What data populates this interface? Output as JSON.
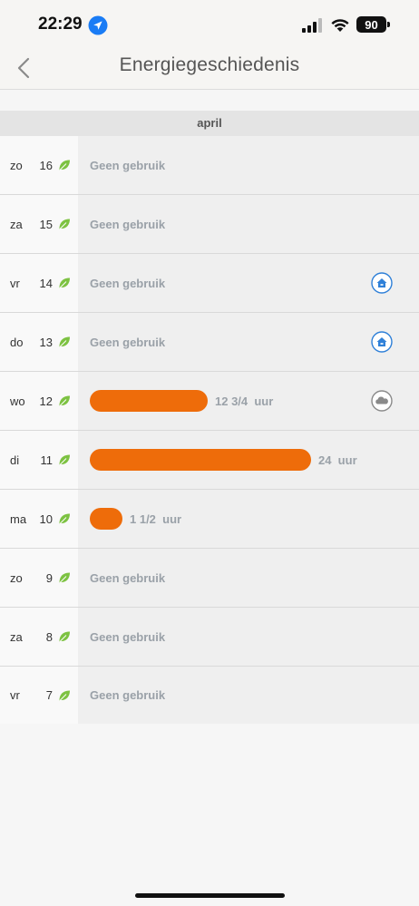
{
  "status_bar": {
    "time": "22:29",
    "battery": "90"
  },
  "header": {
    "title": "Energiegeschiedenis"
  },
  "month": "april",
  "days": [
    {
      "weekday": "zo",
      "day": "16",
      "usage_text": "Geen gebruik",
      "usage_fraction": 0,
      "status_icon": "none"
    },
    {
      "weekday": "za",
      "day": "15",
      "usage_text": "Geen gebruik",
      "usage_fraction": 0,
      "status_icon": "none"
    },
    {
      "weekday": "vr",
      "day": "14",
      "usage_text": "Geen gebruik",
      "usage_fraction": 0,
      "status_icon": "home-icon"
    },
    {
      "weekday": "do",
      "day": "13",
      "usage_text": "Geen gebruik",
      "usage_fraction": 0,
      "status_icon": "home-icon"
    },
    {
      "weekday": "wo",
      "day": "12",
      "usage_text": "12 3/4  uur",
      "usage_fraction": 0.531,
      "status_icon": "cloud-icon"
    },
    {
      "weekday": "di",
      "day": "11",
      "usage_text": "24  uur",
      "usage_fraction": 1.0,
      "status_icon": "none"
    },
    {
      "weekday": "ma",
      "day": "10",
      "usage_text": "1 1/2  uur",
      "usage_fraction": 0.0625,
      "status_icon": "none"
    },
    {
      "weekday": "zo",
      "day": "9",
      "usage_text": "Geen gebruik",
      "usage_fraction": 0,
      "status_icon": "none"
    },
    {
      "weekday": "za",
      "day": "8",
      "usage_text": "Geen gebruik",
      "usage_fraction": 0,
      "status_icon": "none"
    },
    {
      "weekday": "vr",
      "day": "7",
      "usage_text": "Geen gebruik",
      "usage_fraction": 0,
      "status_icon": "none"
    }
  ],
  "colors": {
    "accent": "#ee6c0a",
    "leaf": "#7dc242",
    "home_icon": "#2f80d8",
    "cloud_icon": "#8a8a8a"
  }
}
